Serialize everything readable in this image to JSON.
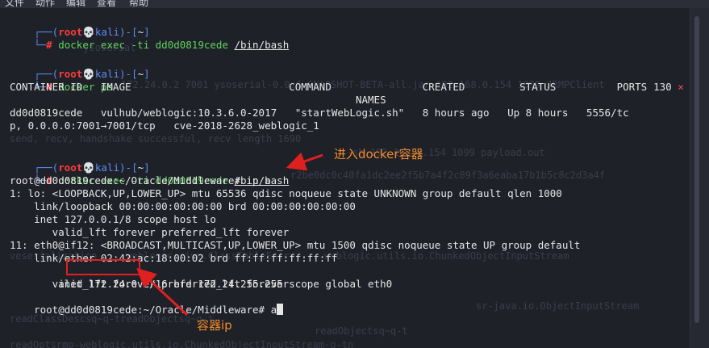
{
  "menu": [
    "文件",
    "动作",
    "编辑",
    "查看",
    "帮助"
  ],
  "prompt": {
    "corner_top": "┌──(",
    "corner_bottom": "└─",
    "user": "root",
    "skull": "💀",
    "host": "kali",
    "mid": ")-[",
    "dir": "~",
    "close": "]",
    "hash": "#"
  },
  "cmd1": {
    "text": "docker exec -ti dd0d0819cede ",
    "arg": "/bin/bash"
  },
  "cmd2": {
    "text": "docker ps",
    "exit_code": "130",
    "exit_mark": "×"
  },
  "ps": {
    "header": "CONTAINER ID   IMAGE                          COMMAND               CREATED         STATUS          PORTS",
    "header2": "                                                         NAMES",
    "row1": "dd0d0819cede   vulhub/weblogic:10.3.6.0-2017   \"startWebLogic.sh\"   8 hours ago   Up 8 hours   5556/tc",
    "row2": "p, 0.0.0.0:7001→7001/tcp   cve-2018-2628_weblogic_1"
  },
  "cmd3": {
    "text": "docker exec -ti dd0d0819cede ",
    "arg": "/bin/bash"
  },
  "container": {
    "l1": "root@dd0d0819cede:~/Oracle/Middleware# ip a",
    "l2": "1: lo: <LOOPBACK,UP,LOWER_UP> mtu 65536 qdisc noqueue state UNKNOWN group default qlen 1000",
    "l3": "    link/loopback 00:00:00:00:00:00 brd 00:00:00:00:00:00",
    "l4": "    inet 127.0.0.1/8 scope host lo",
    "l5": "       valid_lft forever preferred_lft forever",
    "l6": "11: eth0@if12: <BROADCAST,MULTICAST,UP,LOWER_UP> mtu 1500 qdisc noqueue state UP group default",
    "l7": "    link/ether 02:42:ac:18:00:02 brd ff:ff:ff:ff:ff:ff",
    "l8a": "    inet ",
    "l8ip": "172.24.0.2",
    "l8b": "/16 brd 172.24.255.255 scope global eth0",
    "l9": "       valid_lft forever preferred_lft forever",
    "l10": "root@dd0d0819cede:~/Oracle/Middleware# ",
    "l10input": "a"
  },
  "annotations": {
    "enter_docker": "进入docker容器",
    "container_ip": "容器ip"
  },
  "colors": {
    "prompt_blue": "#5c8cf0",
    "root_red": "#ff3b3b",
    "host_green": "#5fd35f",
    "annotation": "#f08a28",
    "highlight": "#e02020"
  }
}
